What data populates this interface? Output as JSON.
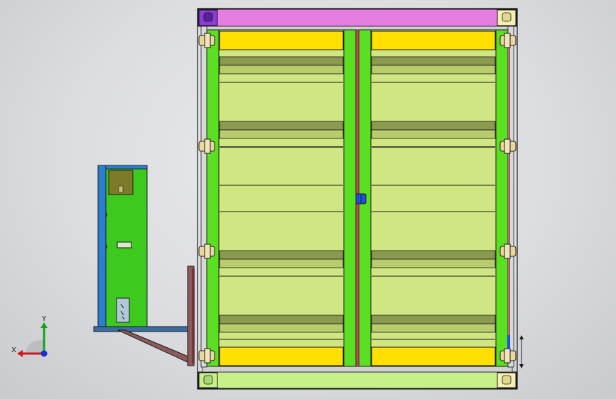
{
  "view": {
    "background_top": "#e9eaec",
    "background_bottom": "#c9cacd",
    "model": "container-front-view"
  },
  "triad": {
    "x_label": "X",
    "y_label": "Y",
    "x_color": "#d01818",
    "y_color": "#18a018",
    "z_color": "#1830d0"
  },
  "colors": {
    "frame_top": "#e57ee0",
    "frame_bottom": "#c8f08a",
    "frame_post": "#5be021",
    "panel": "#cfe682",
    "band_dark": "#8a9a4e",
    "band_mid": "#b8cc6c",
    "bar_yellow": "#ffe000",
    "corner_purple": "#8c3bd6",
    "corner_light": "#f5f0b0",
    "hinge": "#e8d8a0",
    "latch_blue": "#2050d8",
    "cabinet_green": "#3ec91e",
    "cabinet_blue": "#2a7fd0",
    "cabinet_panel": "#7d7b2a",
    "bracket": "#8b5a5a",
    "outline": "#1a1a1a"
  }
}
